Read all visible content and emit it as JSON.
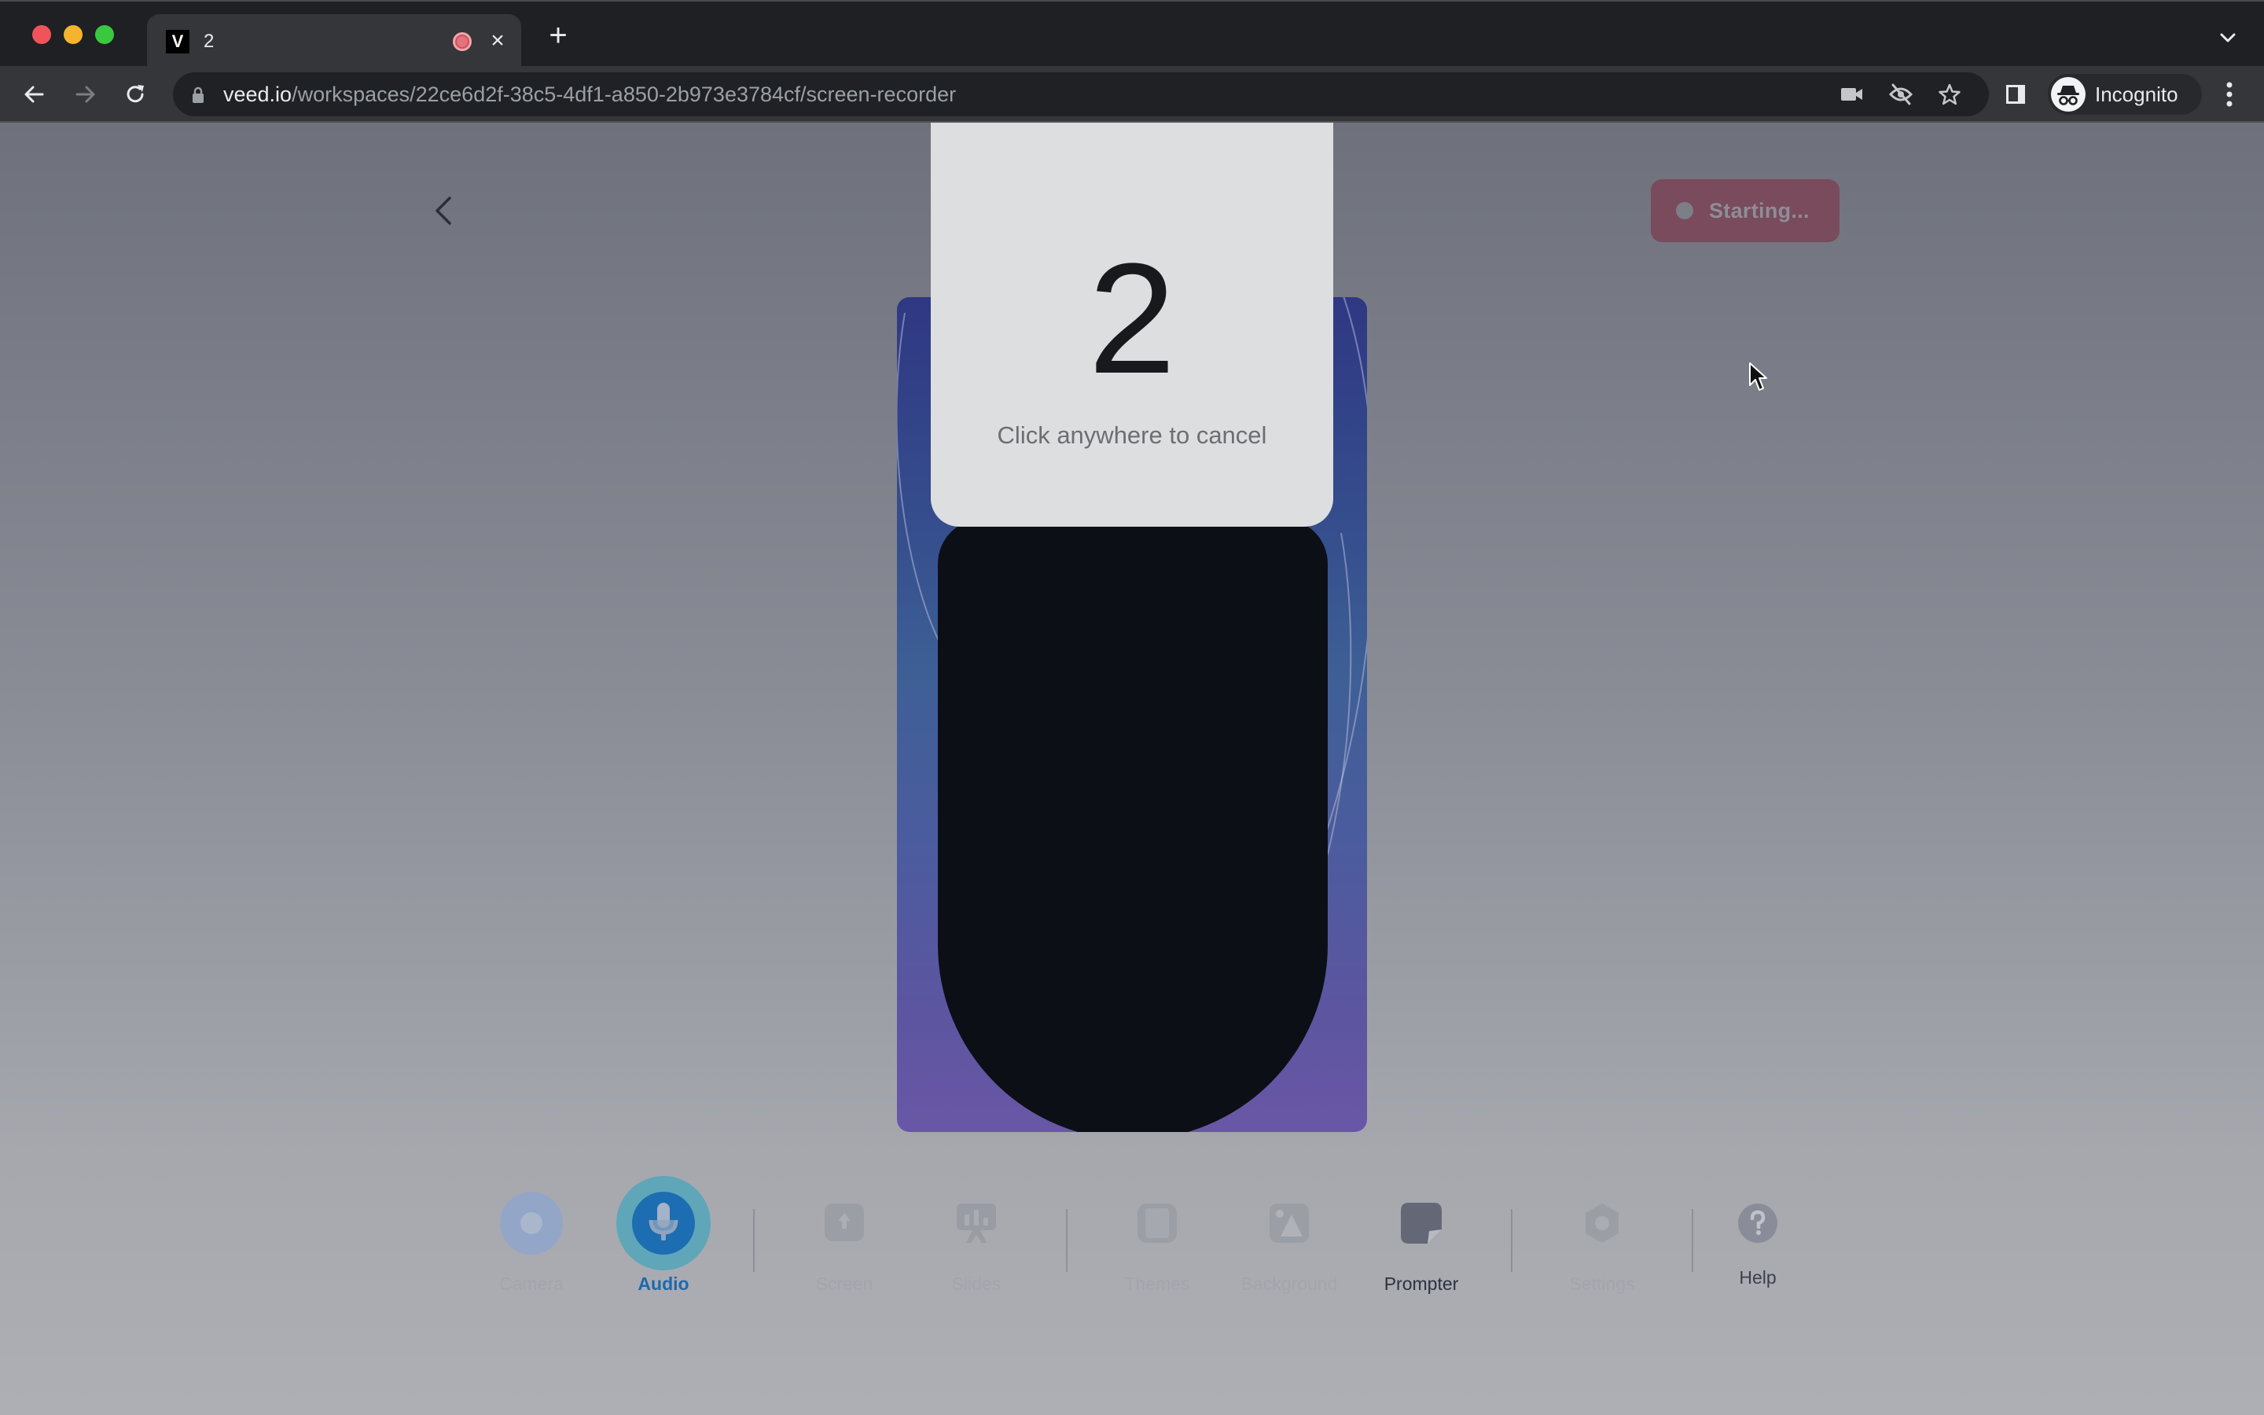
{
  "browser": {
    "tab": {
      "favicon_letter": "V",
      "title": "2",
      "recording_indicator": "recording-dot",
      "close_label": "×"
    },
    "new_tab_label": "+",
    "url": {
      "host": "veed.io",
      "path": "/workspaces/22ce6d2f-38c5-4df1-a850-2b973e3784cf/screen-recorder"
    },
    "toolbar_icons": [
      "camera-in-use-icon",
      "eye-slash-icon",
      "bookmark-star-icon",
      "side-panel-icon"
    ],
    "profile_label": "Incognito"
  },
  "page": {
    "back_icon": "chevron-left-icon",
    "start_button": {
      "label": "Starting...",
      "color": "#7a4a5d"
    },
    "countdown": {
      "number": "2",
      "hint": "Click anywhere to cancel"
    },
    "preview": {
      "gradient_top": "#2f3883",
      "gradient_bottom": "#6957a6",
      "camera_feed_color": "#0c0f16"
    }
  },
  "bottom_toolbar": {
    "items": [
      {
        "id": "camera",
        "label": "Camera",
        "icon": "camera-icon",
        "state": "faded"
      },
      {
        "id": "audio",
        "label": "Audio",
        "icon": "microphone-icon",
        "state": "active"
      },
      {
        "id": "screen",
        "label": "Screen",
        "icon": "screen-share-icon",
        "state": "faded"
      },
      {
        "id": "slides",
        "label": "Slides",
        "icon": "presentation-icon",
        "state": "faded"
      },
      {
        "id": "themes",
        "label": "Themes",
        "icon": "themes-icon",
        "state": "faded"
      },
      {
        "id": "background",
        "label": "Background",
        "icon": "image-icon",
        "state": "faded"
      },
      {
        "id": "prompter",
        "label": "Prompter",
        "icon": "sticky-note-icon",
        "state": "normal"
      },
      {
        "id": "settings",
        "label": "Settings",
        "icon": "gear-icon",
        "state": "faded"
      },
      {
        "id": "help",
        "label": "Help",
        "icon": "help-circle-icon",
        "state": "normal"
      }
    ],
    "active_color": "#1f67b0"
  }
}
